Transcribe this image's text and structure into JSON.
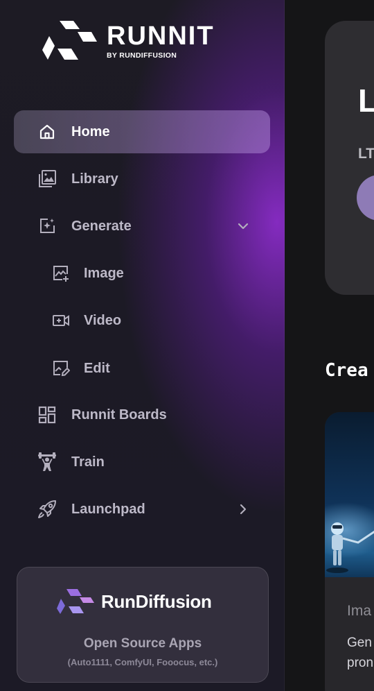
{
  "brand": {
    "name": "RUNNIT",
    "byline": "BY RUNDIFFUSION"
  },
  "nav": {
    "home": "Home",
    "library": "Library",
    "generate": "Generate",
    "image": "Image",
    "video": "Video",
    "edit": "Edit",
    "boards": "Runnit Boards",
    "train": "Train",
    "launchpad": "Launchpad"
  },
  "icons": [
    "home-icon",
    "library-icon",
    "generate-icon",
    "image-icon",
    "video-icon",
    "edit-icon",
    "boards-icon",
    "train-icon",
    "launchpad-icon",
    "chevron-down-icon",
    "chevron-right-icon"
  ],
  "promo": {
    "name": "RunDiffusion",
    "title": "Open Source Apps",
    "subtitle": "(Auto1111, ComfyUI, Fooocus, etc.)"
  },
  "hero": {
    "big_text": "L",
    "sub_text": "LT"
  },
  "section": {
    "title": "Crea"
  },
  "card": {
    "label": "Ima",
    "text_line1": "Gen",
    "text_line2": "pron"
  },
  "colors": {
    "active_bg": "#8f7ab8",
    "accent_purple": "#8a2cc8",
    "sidebar_bg": "#1c1a25",
    "main_bg": "#151517"
  }
}
